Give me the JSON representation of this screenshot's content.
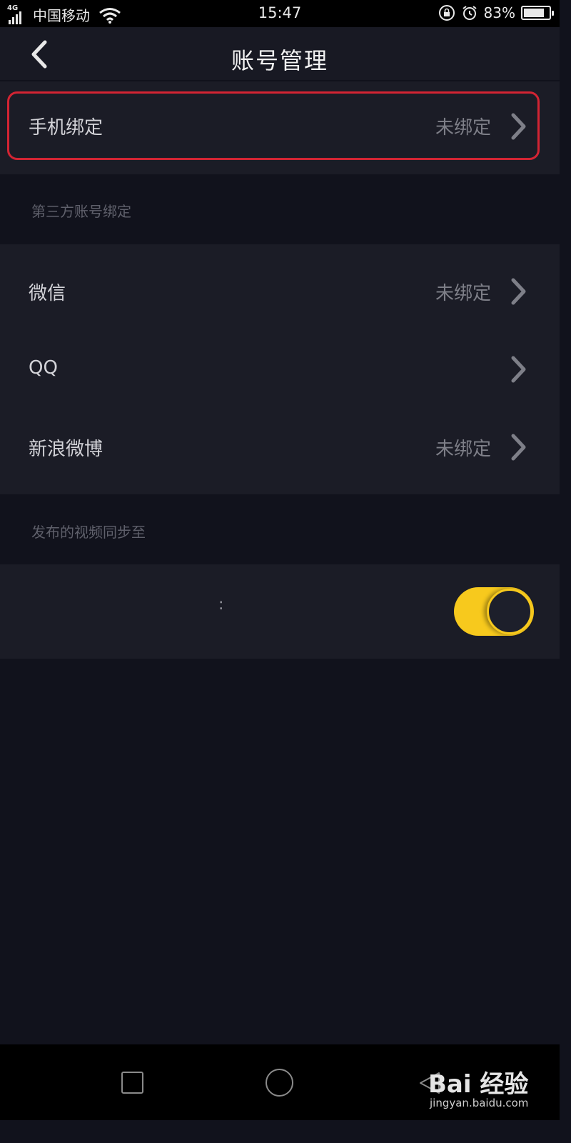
{
  "status_bar": {
    "network": "4G",
    "carrier": "中国移动",
    "time": "15:47",
    "battery": "83%",
    "battery_level": 0.83
  },
  "header": {
    "title": "账号管理"
  },
  "phone_binding": {
    "label": "手机绑定",
    "value": "未绑定"
  },
  "third_party": {
    "caption": "第三方账号绑定",
    "items": [
      {
        "label": "微信",
        "value": "未绑定"
      },
      {
        "label": "QQ",
        "value": ""
      },
      {
        "label": "新浪微博",
        "value": "未绑定"
      }
    ]
  },
  "sync": {
    "caption": "发布的视频同步至",
    "row_label": ":",
    "toggle_on": true
  },
  "colors": {
    "accent": "#f7c91d",
    "highlight": "#d32433",
    "background": "#11121c"
  },
  "watermark": {
    "brand": "Bai  经验",
    "site": "jingyan.baidu.com"
  }
}
